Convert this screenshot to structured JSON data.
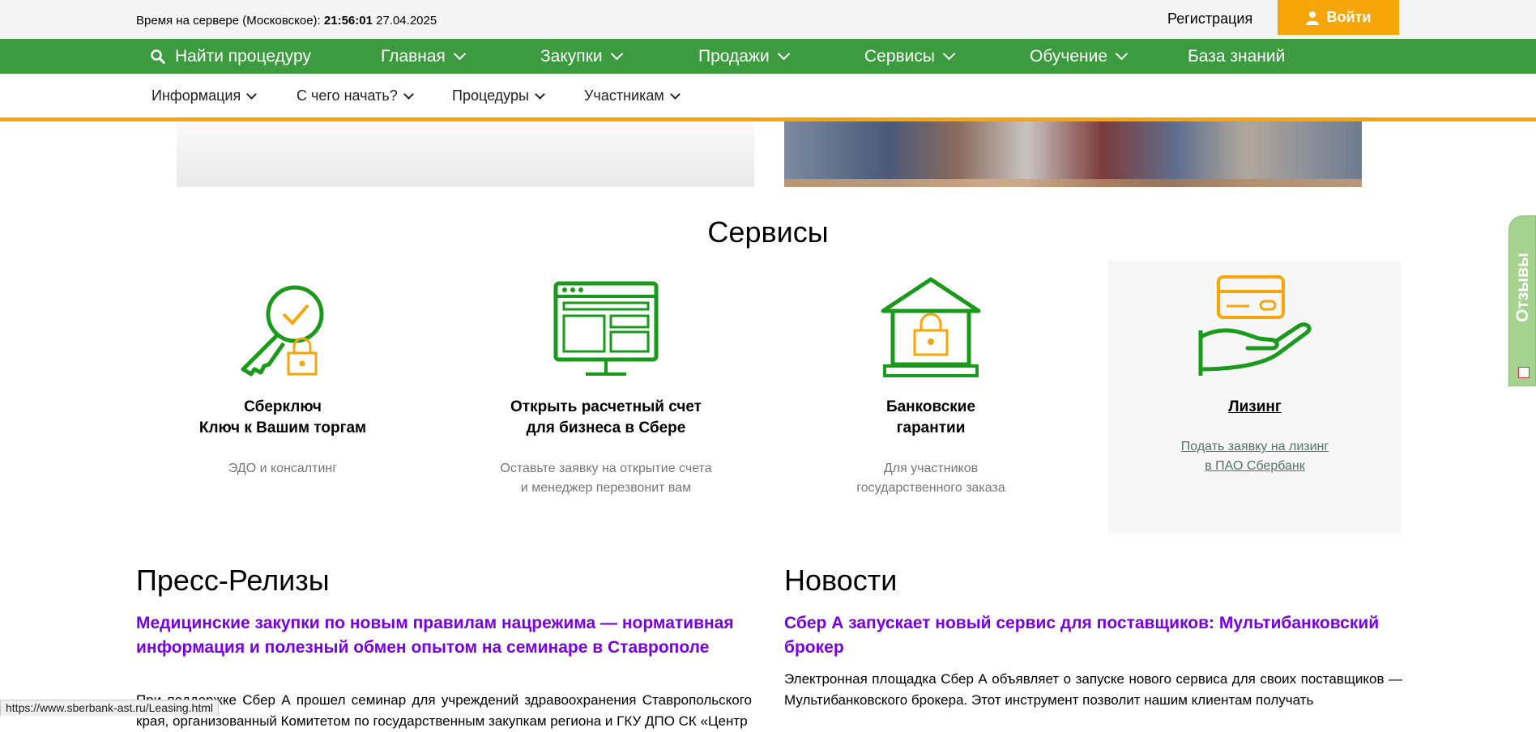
{
  "header": {
    "server_time_label": "Время на сервере (Московское):",
    "server_time": "21:56:01",
    "server_date": "27.04.2025",
    "register": "Регистрация",
    "login": "Войти"
  },
  "nav_main": [
    {
      "label": "Найти процедуру"
    },
    {
      "label": "Главная"
    },
    {
      "label": "Закупки"
    },
    {
      "label": "Продажи"
    },
    {
      "label": "Сервисы"
    },
    {
      "label": "Обучение"
    },
    {
      "label": "База знаний"
    }
  ],
  "nav_sub": [
    {
      "label": "Информация"
    },
    {
      "label": "С чего начать?"
    },
    {
      "label": "Процедуры"
    },
    {
      "label": "Участникам"
    }
  ],
  "services": {
    "title": "Сервисы",
    "items": [
      {
        "title1": "Сберключ",
        "title2": "Ключ к Вашим торгам",
        "sub1": "ЭДО и консалтинг",
        "sub2": ""
      },
      {
        "title1": "Открыть расчетный счет",
        "title2": "для бизнеса в Сбере",
        "sub1": "Оставьте заявку на открытие счета",
        "sub2": "и менеджер перезвонит вам"
      },
      {
        "title1": "Банковские",
        "title2": "гарантии",
        "sub1": "Для участников",
        "sub2": "государственного заказа"
      },
      {
        "title1": "Лизинг",
        "title2": "",
        "sub1": "Подать заявку на лизинг",
        "sub2": "в ПАО Сбербанк"
      }
    ]
  },
  "press": {
    "title": "Пресс-Релизы",
    "article_title": "Медицинские закупки по новым правилам нацрежима — нормативная информация и полезный обмен опытом на семинаре в Ставрополе",
    "article_text": "При поддержке Сбер А прошел семинар для учреждений здравоохранения Ставропольского края, организованный Комитетом по государственным закупкам региона и ГКУ ДПО СК «Центр"
  },
  "news": {
    "title": "Новости",
    "article_title": "Сбер А запускает новый сервис для поставщиков: Мультибанковский брокер",
    "article_text": "Электронная площадка Сбер А объявляет о запуске нового сервиса для своих поставщиков — Мультибанковского брокера. Этот инструмент позволит нашим клиентам получать"
  },
  "feedback_tab": "Отзывы",
  "status_url": "https://www.sberbank-ast.ru/Leasing.html",
  "colors": {
    "green": "#3c9a3f",
    "orange": "#f6a609",
    "purple": "#7a00e6",
    "icon_green": "#1a9a1a",
    "icon_orange": "#f6a609"
  }
}
